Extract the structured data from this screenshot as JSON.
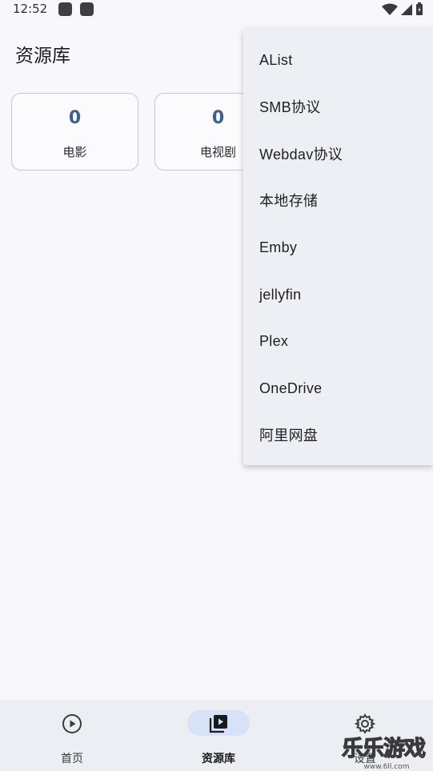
{
  "status_bar": {
    "time": "12:52"
  },
  "header": {
    "title": "资源库"
  },
  "stats": [
    {
      "count": "0",
      "label": "电影"
    },
    {
      "count": "0",
      "label": "电视剧"
    }
  ],
  "menu": {
    "items": [
      "AList",
      "SMB协议",
      "Webdav协议",
      "本地存储",
      "Emby",
      "jellyfin",
      "Plex",
      "OneDrive",
      "阿里网盘"
    ]
  },
  "bottom_nav": {
    "items": [
      {
        "label": "首页",
        "icon": "play-circle-icon",
        "active": false
      },
      {
        "label": "资源库",
        "icon": "video-library-icon",
        "active": true
      },
      {
        "label": "设置",
        "icon": "gear-icon",
        "active": false
      }
    ]
  },
  "watermark": {
    "text": "乐乐游戏",
    "url": "www.6ll.com"
  },
  "colors": {
    "accent": "#3f5f8e",
    "active_pill": "#d6e2f7",
    "menu_bg": "#eeeff4",
    "background": "#f8f8fc"
  }
}
